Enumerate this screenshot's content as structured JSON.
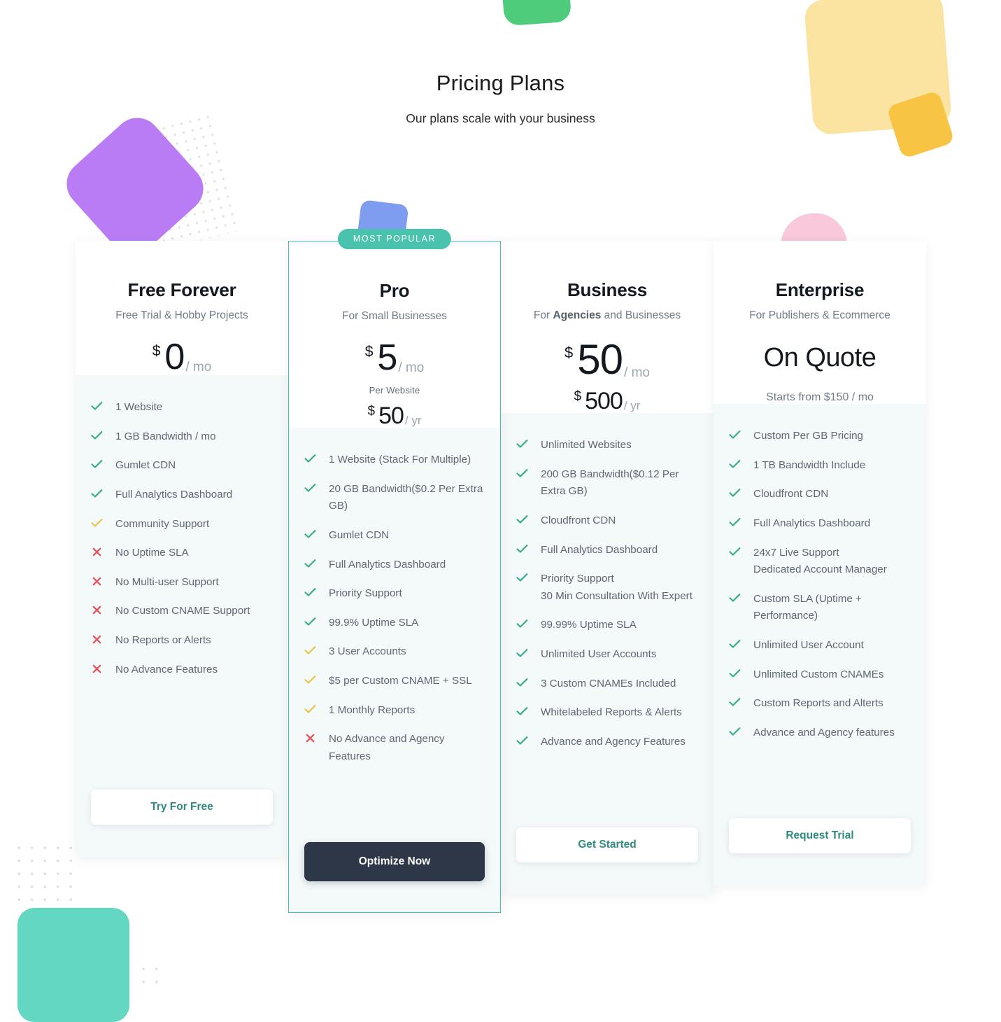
{
  "header": {
    "title": "Pricing Plans",
    "subtitle": "Our plans scale with your business"
  },
  "colors": {
    "check_green": "#3aab8f",
    "check_yellow": "#e8c44a",
    "cross_red": "#e8505b",
    "accent_teal": "#4ac3ae",
    "dark_button": "#2d3748",
    "link_text": "#2e8b7e"
  },
  "badge": {
    "label": "MOST POPULAR"
  },
  "plans": [
    {
      "name": "Free Forever",
      "description": "Free Trial & Hobby Projects",
      "currency": "$",
      "price": "0",
      "period": "/ mo",
      "per_note": "",
      "secondary_currency": "",
      "secondary_price": "",
      "secondary_period": "",
      "quote": "",
      "quote_note": "",
      "cta": "Try For Free",
      "features": [
        {
          "icon": "check-icon",
          "status": "included",
          "text": "1 Website"
        },
        {
          "icon": "check-icon",
          "status": "included",
          "text": "1 GB Bandwidth / mo"
        },
        {
          "icon": "check-icon",
          "status": "included",
          "text": "Gumlet CDN"
        },
        {
          "icon": "check-icon",
          "status": "included",
          "text": "Full Analytics Dashboard"
        },
        {
          "icon": "check-icon",
          "status": "limited",
          "text": "Community Support"
        },
        {
          "icon": "cross-icon",
          "status": "excluded",
          "text": "No Uptime SLA"
        },
        {
          "icon": "cross-icon",
          "status": "excluded",
          "text": "No Multi-user Support"
        },
        {
          "icon": "cross-icon",
          "status": "excluded",
          "text": "No Custom CNAME Support"
        },
        {
          "icon": "cross-icon",
          "status": "excluded",
          "text": "No Reports or Alerts"
        },
        {
          "icon": "cross-icon",
          "status": "excluded",
          "text": "No Advance Features"
        }
      ]
    },
    {
      "name": "Pro",
      "description": "For Small Businesses",
      "currency": "$",
      "price": "5",
      "period": "/ mo",
      "per_note": "Per Website",
      "secondary_currency": "$",
      "secondary_price": "50",
      "secondary_period": "/ yr",
      "quote": "",
      "quote_note": "",
      "cta": "Optimize Now",
      "features": [
        {
          "icon": "check-icon",
          "status": "included",
          "text": "1 Website (Stack For Multiple)"
        },
        {
          "icon": "check-icon",
          "status": "included",
          "text": "20 GB Bandwidth($0.2 Per Extra GB)"
        },
        {
          "icon": "check-icon",
          "status": "included",
          "text": "Gumlet CDN"
        },
        {
          "icon": "check-icon",
          "status": "included",
          "text": "Full Analytics Dashboard"
        },
        {
          "icon": "check-icon",
          "status": "included",
          "text": "Priority Support"
        },
        {
          "icon": "check-icon",
          "status": "included",
          "text": "99.9% Uptime SLA"
        },
        {
          "icon": "check-icon",
          "status": "limited",
          "text": "3 User Accounts"
        },
        {
          "icon": "check-icon",
          "status": "limited",
          "text": "$5 per Custom CNAME + SSL"
        },
        {
          "icon": "check-icon",
          "status": "limited",
          "text": "1 Monthly Reports"
        },
        {
          "icon": "cross-icon",
          "status": "excluded",
          "text": "No Advance and Agency Features"
        }
      ]
    },
    {
      "name": "Business",
      "description_prefix": "For ",
      "description_bold": "Agencies",
      "description_suffix": " and Businesses",
      "description": "For Agencies and Businesses",
      "currency": "$",
      "price": "50",
      "period": "/ mo",
      "per_note": "",
      "secondary_currency": "$",
      "secondary_price": "500",
      "secondary_period": "/ yr",
      "quote": "",
      "quote_note": "",
      "cta": "Get Started",
      "features": [
        {
          "icon": "check-icon",
          "status": "included",
          "text": "Unlimited Websites"
        },
        {
          "icon": "check-icon",
          "status": "included",
          "text": "200 GB Bandwidth($0.12 Per Extra GB)"
        },
        {
          "icon": "check-icon",
          "status": "included",
          "text": "Cloudfront CDN"
        },
        {
          "icon": "check-icon",
          "status": "included",
          "text": "Full Analytics Dashboard"
        },
        {
          "icon": "check-icon",
          "status": "included",
          "text": "Priority Support\n30 Min Consultation With Expert"
        },
        {
          "icon": "check-icon",
          "status": "included",
          "text": "99.99% Uptime SLA"
        },
        {
          "icon": "check-icon",
          "status": "included",
          "text": "Unlimited User Accounts"
        },
        {
          "icon": "check-icon",
          "status": "included",
          "text": "3 Custom CNAMEs Included"
        },
        {
          "icon": "check-icon",
          "status": "included",
          "text": "Whitelabeled Reports & Alerts"
        },
        {
          "icon": "check-icon",
          "status": "included",
          "text": "Advance and Agency Features"
        }
      ]
    },
    {
      "name": "Enterprise",
      "description": "For Publishers & Ecommerce",
      "currency": "",
      "price": "",
      "period": "",
      "per_note": "",
      "secondary_currency": "",
      "secondary_price": "",
      "secondary_period": "",
      "quote": "On Quote",
      "quote_note": "Starts from $150 / mo",
      "cta": "Request Trial",
      "features": [
        {
          "icon": "check-icon",
          "status": "included",
          "text": "Custom Per GB Pricing"
        },
        {
          "icon": "check-icon",
          "status": "included",
          "text": "1 TB Bandwidth Include"
        },
        {
          "icon": "check-icon",
          "status": "included",
          "text": "Cloudfront CDN"
        },
        {
          "icon": "check-icon",
          "status": "included",
          "text": "Full Analytics Dashboard"
        },
        {
          "icon": "check-icon",
          "status": "included",
          "text": "24x7 Live Support\nDedicated Account Manager"
        },
        {
          "icon": "check-icon",
          "status": "included",
          "text": "Custom SLA (Uptime + Performance)"
        },
        {
          "icon": "check-icon",
          "status": "included",
          "text": "Unlimited User Account"
        },
        {
          "icon": "check-icon",
          "status": "included",
          "text": "Unlimited Custom CNAMEs"
        },
        {
          "icon": "check-icon",
          "status": "included",
          "text": "Custom Reports and Alterts"
        },
        {
          "icon": "check-icon",
          "status": "included",
          "text": "Advance and Agency features"
        }
      ]
    }
  ]
}
